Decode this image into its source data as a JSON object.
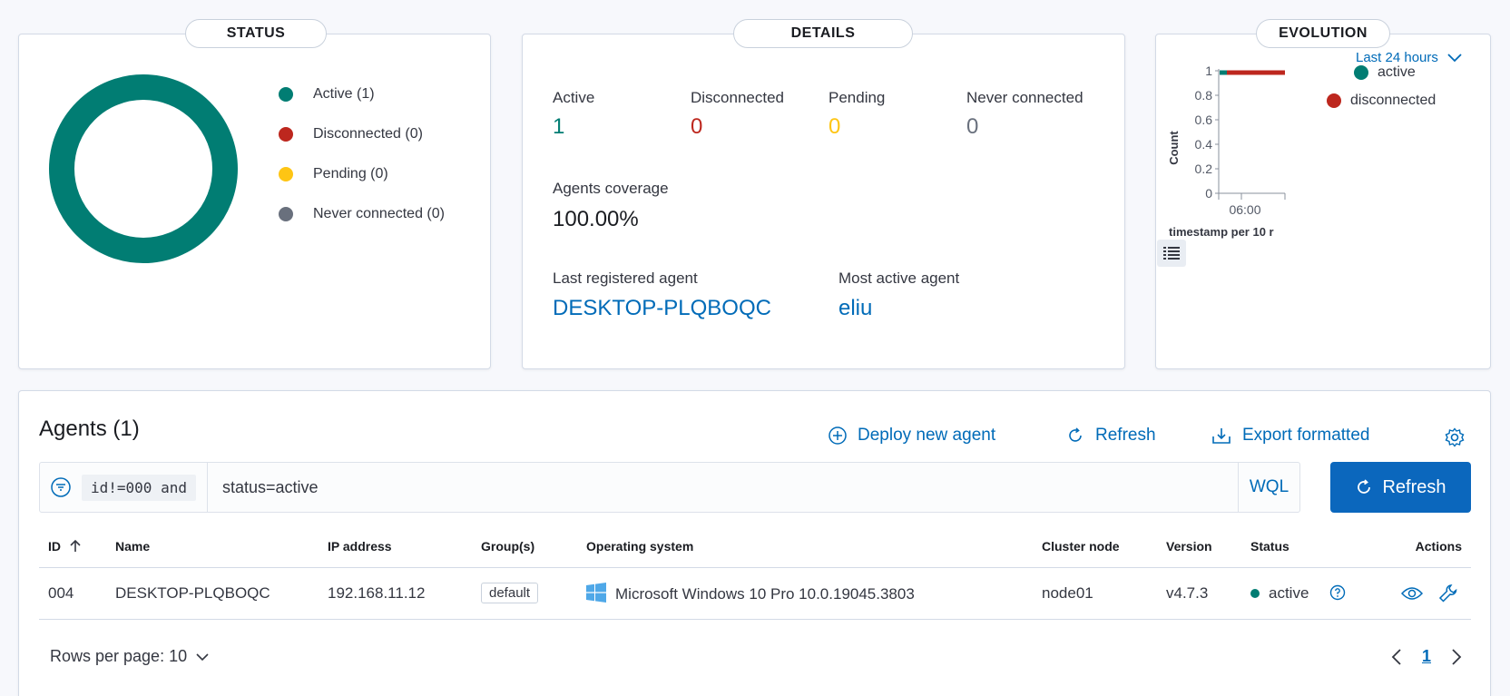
{
  "status": {
    "title": "STATUS",
    "legend": [
      {
        "label": "Active (1)",
        "color": "#017d73"
      },
      {
        "label": "Disconnected (0)",
        "color": "#bd271e"
      },
      {
        "label": "Pending (0)",
        "color": "#fec514"
      },
      {
        "label": "Never connected (0)",
        "color": "#69707d"
      }
    ],
    "donut_color": "#017d73"
  },
  "details": {
    "title": "DETAILS",
    "active_label": "Active",
    "active_value": "1",
    "disconnected_label": "Disconnected",
    "disconnected_value": "0",
    "pending_label": "Pending",
    "pending_value": "0",
    "never_label": "Never connected",
    "never_value": "0",
    "coverage_label": "Agents coverage",
    "coverage_value": "100.00%",
    "last_registered_label": "Last registered agent",
    "last_registered_value": "DESKTOP-PLQBOQC",
    "most_active_label": "Most active agent",
    "most_active_value": "eliu"
  },
  "evolution": {
    "title": "EVOLUTION",
    "range": "Last 24 hours",
    "y_label": "Count",
    "x_label": "timestamp per 10 r",
    "y_ticks": [
      "1",
      "0.8",
      "0.6",
      "0.4",
      "0.2",
      "0"
    ],
    "x_tick": "06:00",
    "legend": [
      {
        "label": "active",
        "color": "#017d73"
      },
      {
        "label": "disconnected",
        "color": "#bd271e"
      }
    ]
  },
  "agents": {
    "title": "Agents (1)",
    "deploy_label": "Deploy new agent",
    "refresh_label": "Refresh",
    "export_label": "Export formatted",
    "query_prefix": "id!=000 and",
    "query_value": "status=active",
    "wql_label": "WQL",
    "refresh_button": "Refresh",
    "columns": {
      "id": "ID",
      "name": "Name",
      "ip": "IP address",
      "group": "Group(s)",
      "os": "Operating system",
      "node": "Cluster node",
      "version": "Version",
      "status": "Status",
      "actions": "Actions"
    },
    "rows": [
      {
        "id": "004",
        "name": "DESKTOP-PLQBOQC",
        "ip": "192.168.11.12",
        "group": "default",
        "os": "Microsoft Windows 10 Pro 10.0.19045.3803",
        "node": "node01",
        "version": "v4.7.3",
        "status": "active"
      }
    ],
    "rows_per_page": "Rows per page: 10",
    "page": "1"
  }
}
